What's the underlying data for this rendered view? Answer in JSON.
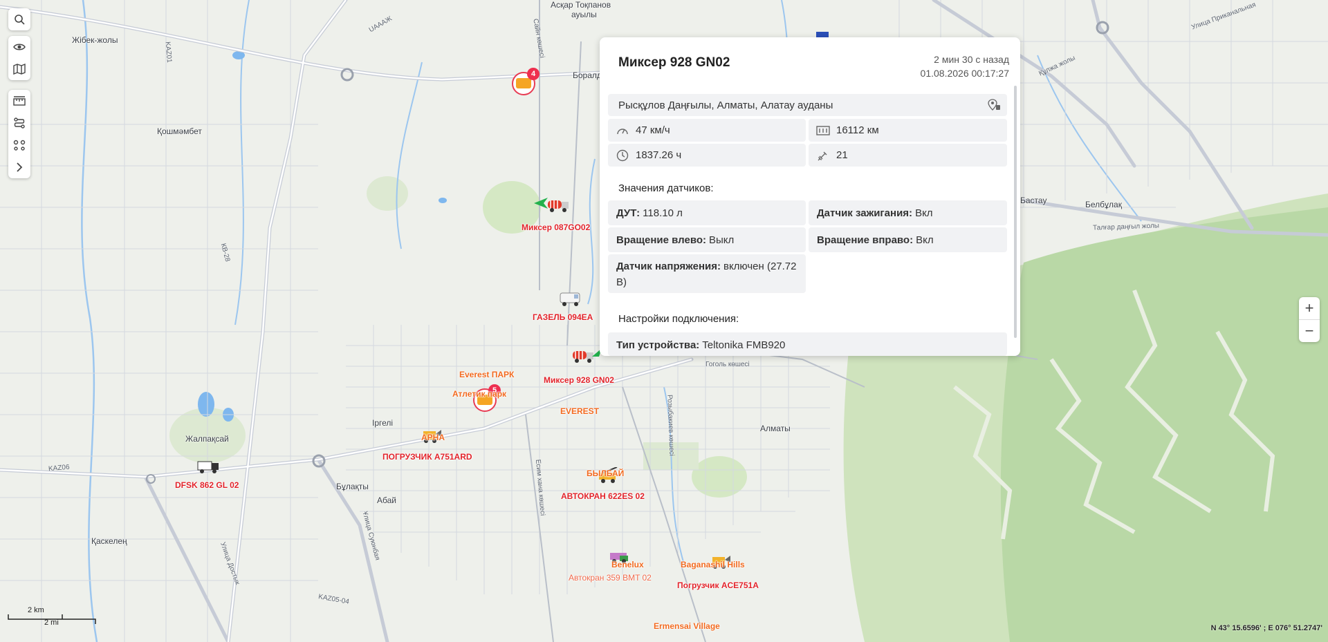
{
  "map": {
    "places": [
      {
        "name": "Асқар Тоқпанов",
        "cls": ""
      },
      {
        "name": "ауылы",
        "cls": ""
      },
      {
        "name": "Жібек-жолы",
        "cls": ""
      },
      {
        "name": "Қошмәмбет",
        "cls": ""
      },
      {
        "name": "Жалпақсай",
        "cls": ""
      },
      {
        "name": "Іргелі",
        "cls": ""
      },
      {
        "name": "Бұлақты",
        "cls": ""
      },
      {
        "name": "Абай",
        "cls": ""
      },
      {
        "name": "Қаскелең",
        "cls": ""
      },
      {
        "name": "Алматы",
        "cls": ""
      },
      {
        "name": "Бастау",
        "cls": ""
      },
      {
        "name": "Белбұлақ",
        "cls": ""
      },
      {
        "name": "Боралдай",
        "cls": ""
      }
    ],
    "roads": [
      "KAZ01",
      "КВ-28",
      "UAAAЖ",
      "Сайн көшесі",
      "KAZ06",
      "KAZ05-04",
      "Ұлица Суюнбая",
      "Гоголь көшесі",
      "Розыбакиев көшесі",
      "Есим хана көшесі",
      "Улица Приканальная",
      "Құлжа жолы",
      "Талғар даңғыл жолы",
      "Улица Достык"
    ],
    "vehicle_labels": {
      "v1": "Миксер 087GO02",
      "v2": "ГАЗЕЛЬ 094EA",
      "v3": "Миксер 928 GN02",
      "v4": "EVEREST",
      "v5": "Everest ПАРК",
      "v6": "Атлетик парк",
      "v7": "ПОГРУЗЧИК A751ARD",
      "v8": "АРНА",
      "v9": "DFSK 862 GL 02",
      "v10": "БЫЛБАЙ",
      "v11": "АВТОКРАН 622ES 02",
      "v12": "Benelux",
      "v13": "Автокран 359 BMT 02",
      "v14": "Baganashil Hills",
      "v15": "Погрузчик ACE751A",
      "v16": "Ermensai Village"
    },
    "clusters": [
      {
        "count": "4"
      },
      {
        "count": "5"
      }
    ],
    "colors": {
      "water": "#7eb7ee",
      "park": "#d5e8c4",
      "forest": "#b9d8a6",
      "road": "#ffffff",
      "major": "#c6cbd6",
      "accent_red": "#e2232a",
      "accent_orange": "#f26a1f"
    }
  },
  "toolbar": {
    "icons": [
      "search-icon",
      "eye-icon",
      "map-icon",
      "ruler-icon",
      "route-icon",
      "geofence-icon",
      "chevron-right-icon"
    ]
  },
  "zoom": {
    "plus": "+",
    "minus": "−"
  },
  "popup": {
    "title": "Миксер 928 GN02",
    "ago": "2 мин 30 с назад",
    "datetime": "01.08.2026 00:17:27",
    "address": "Рысқұлов Даңғылы, Алматы, Алатау ауданы",
    "speed": "47 км/ч",
    "mileage": "16112 км",
    "engine_hours": "1837.26 ч",
    "satellites": "21",
    "sensors_title": "Значения датчиков:",
    "sensors": [
      {
        "k": "ДУТ:",
        "v": "118.10 л"
      },
      {
        "k": "Датчик зажигания:",
        "v": "Вкл"
      },
      {
        "k": "Вращение влево:",
        "v": "Выкл"
      },
      {
        "k": "Вращение вправо:",
        "v": "Вкл"
      },
      {
        "k": "Датчик напряжения:",
        "v": "включен (27.72 В)"
      }
    ],
    "conn_title": "Настройки подключения:",
    "device": {
      "k": "Тип устройства:",
      "v": "Teltonika FMB920"
    }
  },
  "scale": {
    "km": "2 km",
    "mi": "2 mi"
  },
  "coords": "N 43° 15.6596' ; E 076° 51.2747'"
}
